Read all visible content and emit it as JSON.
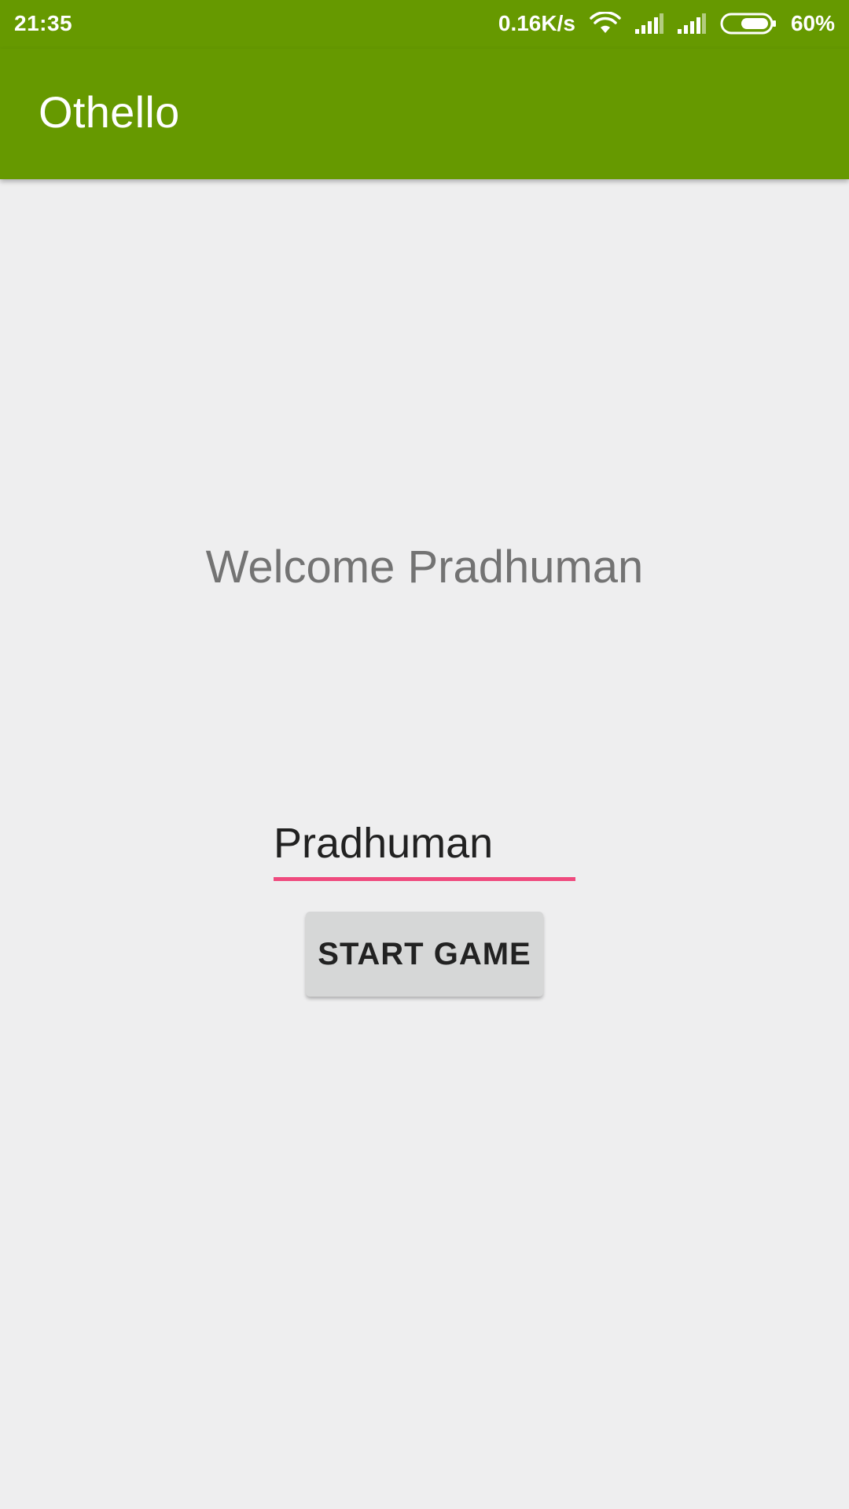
{
  "status_bar": {
    "time": "21:35",
    "network_speed": "0.16K/s",
    "battery_percent": "60%",
    "battery_level": 0.6,
    "icons": [
      "wifi-icon",
      "signal-icon",
      "signal-icon",
      "battery-icon"
    ]
  },
  "app_bar": {
    "title": "Othello",
    "color": "#669900"
  },
  "main": {
    "welcome_text": "Welcome Pradhuman",
    "name_input": {
      "value": "Pradhuman",
      "underline_color": "#ef4a7e"
    },
    "start_button_label": "START GAME"
  },
  "colors": {
    "primary": "#669900",
    "accent": "#ef4a7e",
    "background": "#eeeeef"
  }
}
